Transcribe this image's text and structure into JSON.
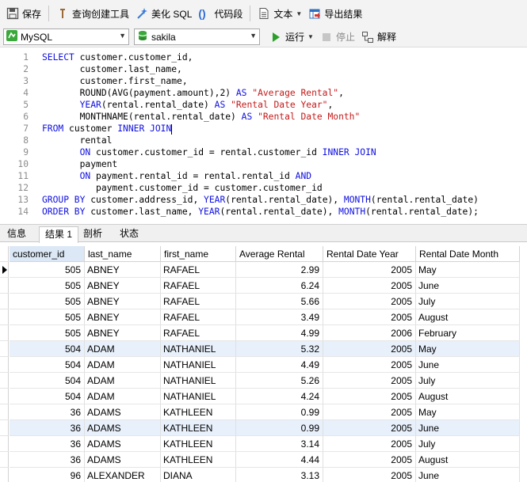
{
  "toolbar": {
    "save": "保存",
    "query_builder": "查询创建工具",
    "beautify_sql": "美化 SQL",
    "code_snippet": "代码段",
    "text": "文本",
    "export_results": "导出结果"
  },
  "toolbar2": {
    "connection": "MySQL",
    "database": "sakila",
    "run": "运行",
    "stop": "停止",
    "explain": "解释"
  },
  "editor": {
    "lines": [
      [
        {
          "t": "SELECT ",
          "c": "kw"
        },
        {
          "t": "customer.customer_id,"
        }
      ],
      [
        {
          "t": "       customer.last_name,"
        }
      ],
      [
        {
          "t": "       customer.first_name,"
        }
      ],
      [
        {
          "t": "       ROUND(AVG(payment.amount),2) "
        },
        {
          "t": "AS ",
          "c": "kw"
        },
        {
          "t": "\"Average Rental\"",
          "c": "str"
        },
        {
          "t": ","
        }
      ],
      [
        {
          "t": "       "
        },
        {
          "t": "YEAR",
          "c": "kw"
        },
        {
          "t": "(rental.rental_date) "
        },
        {
          "t": "AS ",
          "c": "kw"
        },
        {
          "t": "\"Rental Date Year\"",
          "c": "str"
        },
        {
          "t": ","
        }
      ],
      [
        {
          "t": "       MONTHNAME(rental.rental_date) "
        },
        {
          "t": "AS ",
          "c": "kw"
        },
        {
          "t": "\"Rental Date Month\"",
          "c": "str"
        }
      ],
      [
        {
          "t": "FROM ",
          "c": "kw"
        },
        {
          "t": "customer "
        },
        {
          "t": "INNER JOIN",
          "c": "kw"
        },
        {
          "cursor": true
        }
      ],
      [
        {
          "t": "       rental"
        }
      ],
      [
        {
          "t": "       "
        },
        {
          "t": "ON ",
          "c": "kw"
        },
        {
          "t": "customer.customer_id = rental.customer_id "
        },
        {
          "t": "INNER JOIN",
          "c": "kw"
        }
      ],
      [
        {
          "t": "       payment"
        }
      ],
      [
        {
          "t": "       "
        },
        {
          "t": "ON ",
          "c": "kw"
        },
        {
          "t": "payment.rental_id = rental.rental_id "
        },
        {
          "t": "AND",
          "c": "kw"
        }
      ],
      [
        {
          "t": "          payment.customer_id = customer.customer_id"
        }
      ],
      [
        {
          "t": "GROUP BY ",
          "c": "kw"
        },
        {
          "t": "customer.address_id, "
        },
        {
          "t": "YEAR",
          "c": "kw"
        },
        {
          "t": "(rental.rental_date), "
        },
        {
          "t": "MONTH",
          "c": "kw"
        },
        {
          "t": "(rental.rental_date)"
        }
      ],
      [
        {
          "t": "ORDER BY ",
          "c": "kw"
        },
        {
          "t": "customer.last_name, "
        },
        {
          "t": "YEAR",
          "c": "kw"
        },
        {
          "t": "(rental.rental_date), "
        },
        {
          "t": "MONTH",
          "c": "kw"
        },
        {
          "t": "(rental.rental_date);"
        }
      ]
    ]
  },
  "tabs": [
    "信息",
    "结果 1",
    "剖析",
    "状态"
  ],
  "results": {
    "columns": [
      "customer_id",
      "last_name",
      "first_name",
      "Average Rental",
      "Rental Date Year",
      "Rental Date Month"
    ],
    "rows": [
      [
        "505",
        "ABNEY",
        "RAFAEL",
        "2.99",
        "2005",
        "May"
      ],
      [
        "505",
        "ABNEY",
        "RAFAEL",
        "6.24",
        "2005",
        "June"
      ],
      [
        "505",
        "ABNEY",
        "RAFAEL",
        "5.66",
        "2005",
        "July"
      ],
      [
        "505",
        "ABNEY",
        "RAFAEL",
        "3.49",
        "2005",
        "August"
      ],
      [
        "505",
        "ABNEY",
        "RAFAEL",
        "4.99",
        "2006",
        "February"
      ],
      [
        "504",
        "ADAM",
        "NATHANIEL",
        "5.32",
        "2005",
        "May"
      ],
      [
        "504",
        "ADAM",
        "NATHANIEL",
        "4.49",
        "2005",
        "June"
      ],
      [
        "504",
        "ADAM",
        "NATHANIEL",
        "5.26",
        "2005",
        "July"
      ],
      [
        "504",
        "ADAM",
        "NATHANIEL",
        "4.24",
        "2005",
        "August"
      ],
      [
        "36",
        "ADAMS",
        "KATHLEEN",
        "0.99",
        "2005",
        "May"
      ],
      [
        "36",
        "ADAMS",
        "KATHLEEN",
        "0.99",
        "2005",
        "June"
      ],
      [
        "36",
        "ADAMS",
        "KATHLEEN",
        "3.14",
        "2005",
        "July"
      ],
      [
        "36",
        "ADAMS",
        "KATHLEEN",
        "4.44",
        "2005",
        "August"
      ],
      [
        "96",
        "ALEXANDER",
        "DIANA",
        "3.13",
        "2005",
        "June"
      ]
    ]
  }
}
